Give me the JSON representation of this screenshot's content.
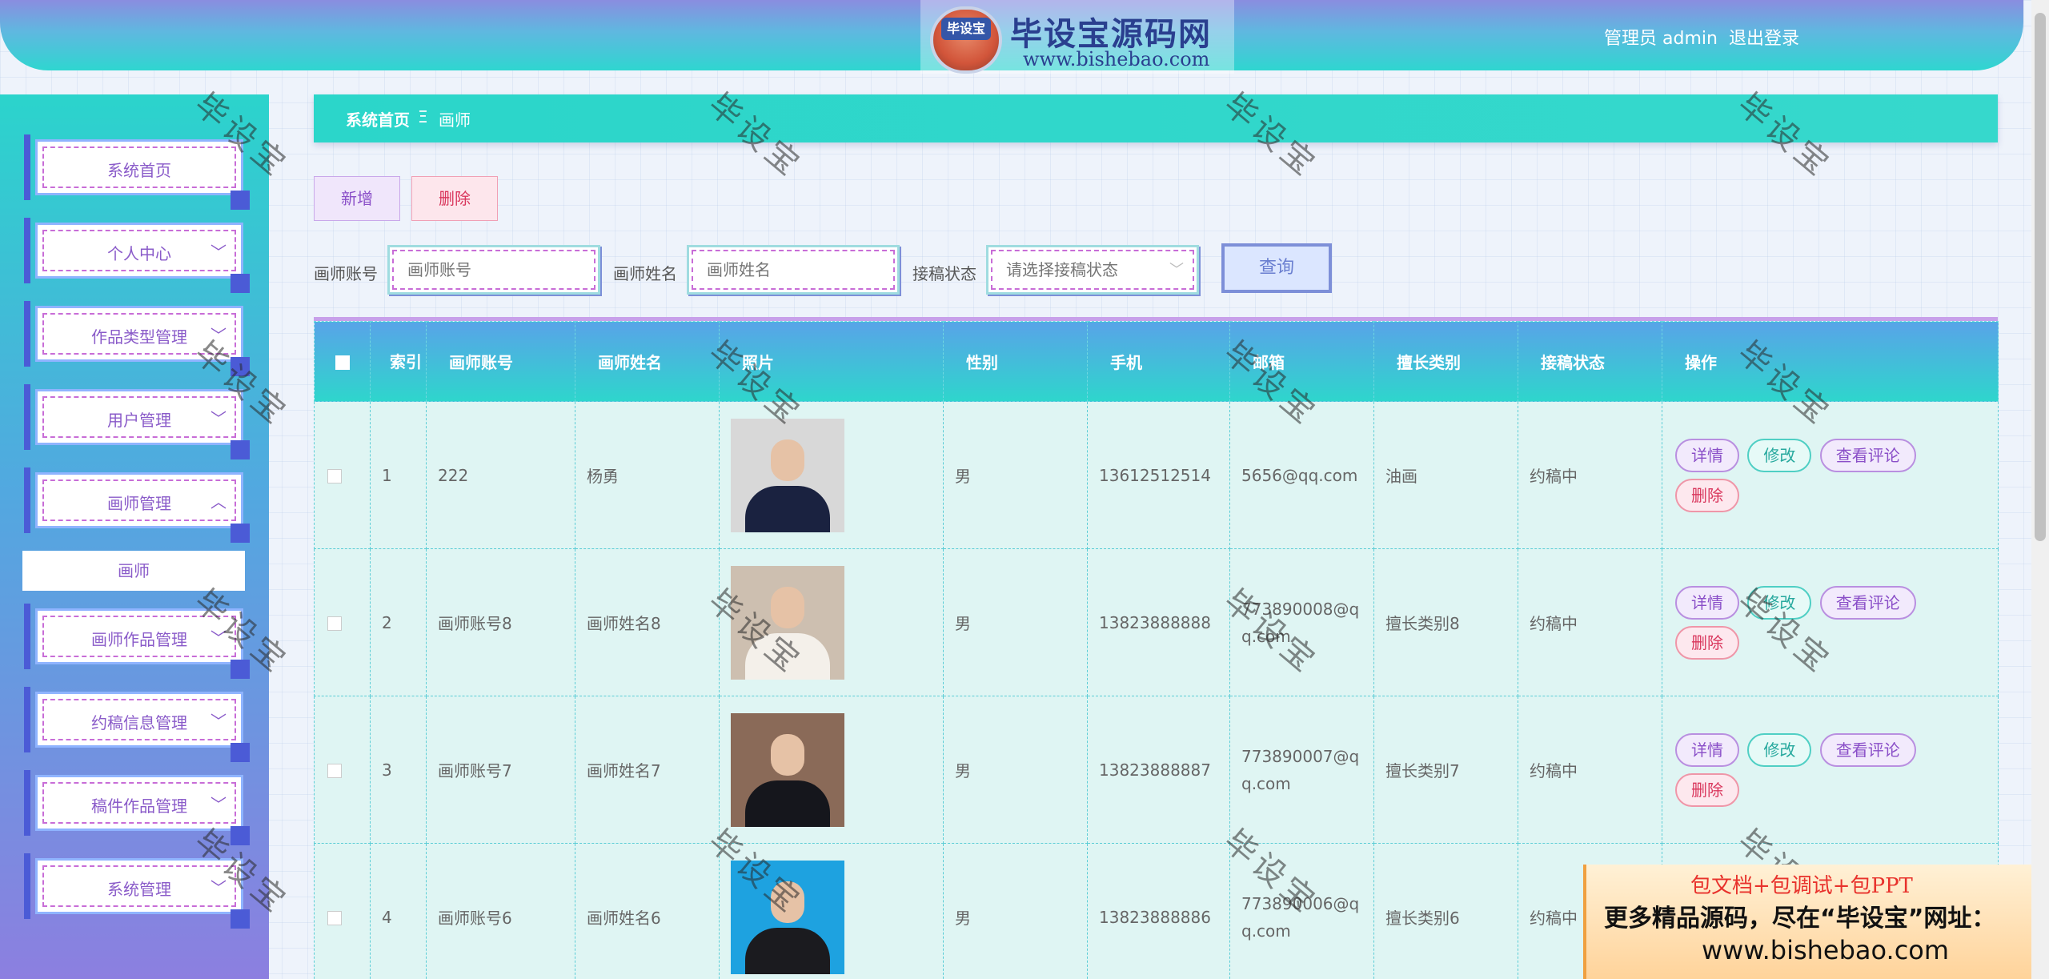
{
  "header": {
    "logo_badge": "毕设宝",
    "logo_title": "毕设宝源码网",
    "logo_url": "www.bishebao.com",
    "user": "管理员 admin",
    "logout": "退出登录"
  },
  "sidebar": {
    "items": [
      {
        "label": "系统首页",
        "chevron": ""
      },
      {
        "label": "个人中心",
        "chevron": "﹀"
      },
      {
        "label": "作品类型管理",
        "chevron": "﹀"
      },
      {
        "label": "用户管理",
        "chevron": "﹀"
      },
      {
        "label": "画师管理",
        "chevron": "︿"
      },
      {
        "label": "画师作品管理",
        "chevron": "﹀"
      },
      {
        "label": "约稿信息管理",
        "chevron": "﹀"
      },
      {
        "label": "稿件作品管理",
        "chevron": "﹀"
      },
      {
        "label": "系统管理",
        "chevron": "﹀"
      }
    ],
    "submenu_active": "画师"
  },
  "breadcrumb": {
    "home": "系统首页",
    "separator": "Ξ",
    "current": "画师"
  },
  "actions": {
    "add": "新增",
    "delete": "删除"
  },
  "search": {
    "account_label": "画师账号",
    "account_placeholder": "画师账号",
    "name_label": "画师姓名",
    "name_placeholder": "画师姓名",
    "status_label": "接稿状态",
    "status_placeholder": "请选择接稿状态",
    "query": "查询"
  },
  "table": {
    "headers": [
      "",
      "索引",
      "画师账号",
      "画师姓名",
      "照片",
      "性别",
      "手机",
      "邮箱",
      "擅长类别",
      "接稿状态",
      "操作"
    ],
    "rows": [
      {
        "index": "1",
        "account": "222",
        "name": "杨勇",
        "gender": "男",
        "phone": "13612512514",
        "email": "5656@qq.com",
        "category": "油画",
        "status": "约稿中"
      },
      {
        "index": "2",
        "account": "画师账号8",
        "name": "画师姓名8",
        "gender": "男",
        "phone": "13823888888",
        "email": "773890008@qq.com",
        "category": "擅长类别8",
        "status": "约稿中"
      },
      {
        "index": "3",
        "account": "画师账号7",
        "name": "画师姓名7",
        "gender": "男",
        "phone": "13823888887",
        "email": "773890007@qq.com",
        "category": "擅长类别7",
        "status": "约稿中"
      },
      {
        "index": "4",
        "account": "画师账号6",
        "name": "画师姓名6",
        "gender": "男",
        "phone": "13823888886",
        "email": "773890006@qq.com",
        "category": "擅长类别6",
        "status": "约稿中"
      }
    ],
    "ops": {
      "detail": "详情",
      "edit": "修改",
      "review": "查看评论",
      "delete": "删除"
    }
  },
  "watermark": "毕设宝",
  "ad": {
    "line1": "包文档+包调试+包PPT",
    "line2": "更多精品源码，尽在“毕设宝”网址：",
    "line3": "www.bishebao.com"
  },
  "colors": {
    "accent": "#2bd6ca",
    "primary_purple": "#8a4fc8",
    "danger": "#d9365c"
  }
}
